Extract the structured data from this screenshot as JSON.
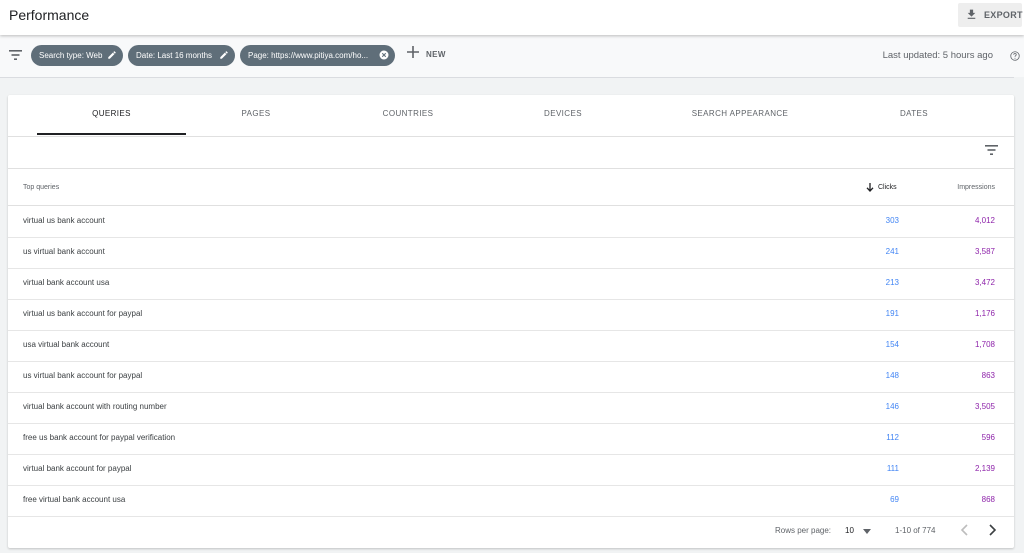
{
  "header": {
    "title": "Performance",
    "export_label": "EXPORT"
  },
  "filters": {
    "chips": [
      {
        "label": "Search type: Web"
      },
      {
        "label": "Date: Last 16 months"
      },
      {
        "label": "Page: https://www.pitiya.com/ho..."
      }
    ],
    "new_label": "NEW",
    "last_updated": "Last updated: 5 hours ago"
  },
  "tabs": [
    {
      "label": "QUERIES",
      "active": true
    },
    {
      "label": "PAGES"
    },
    {
      "label": "COUNTRIES"
    },
    {
      "label": "DEVICES"
    },
    {
      "label": "SEARCH APPEARANCE"
    },
    {
      "label": "DATES"
    }
  ],
  "table": {
    "columns": {
      "query": "Top queries",
      "clicks": "Clicks",
      "impressions": "Impressions"
    },
    "rows": [
      {
        "query": "virtual us bank account",
        "clicks": "303",
        "impressions": "4,012"
      },
      {
        "query": "us virtual bank account",
        "clicks": "241",
        "impressions": "3,587"
      },
      {
        "query": "virtual bank account usa",
        "clicks": "213",
        "impressions": "3,472"
      },
      {
        "query": "virtual us bank account for paypal",
        "clicks": "191",
        "impressions": "1,176"
      },
      {
        "query": "usa virtual bank account",
        "clicks": "154",
        "impressions": "1,708"
      },
      {
        "query": "us virtual bank account for paypal",
        "clicks": "148",
        "impressions": "863"
      },
      {
        "query": "virtual bank account with routing number",
        "clicks": "146",
        "impressions": "3,505"
      },
      {
        "query": "free us bank account for paypal verification",
        "clicks": "112",
        "impressions": "596"
      },
      {
        "query": "virtual bank account for paypal",
        "clicks": "111",
        "impressions": "2,139"
      },
      {
        "query": "free virtual bank account usa",
        "clicks": "69",
        "impressions": "868"
      }
    ]
  },
  "pagination": {
    "rows_per_page_label": "Rows per page:",
    "rows_per_page": "10",
    "range": "1-10 of 774"
  },
  "colors": {
    "clicks": "#4285f4",
    "impressions": "#8e24aa",
    "chip": "#5f6e79"
  }
}
